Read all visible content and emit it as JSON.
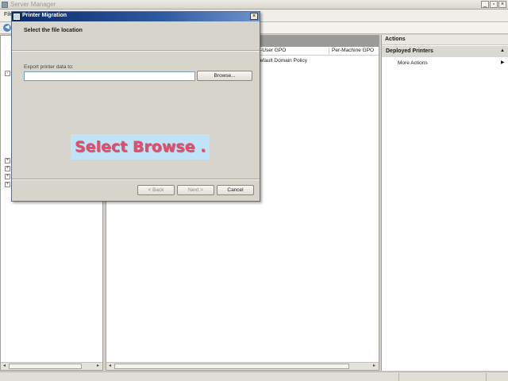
{
  "window": {
    "title": "Server Manager"
  },
  "menu": {
    "items": [
      "File"
    ]
  },
  "tree": {
    "expanders": [
      "-",
      "+",
      "+",
      "+",
      "+"
    ]
  },
  "table": {
    "columns": [
      "Per-User GPO",
      "Per-Machine GPO"
    ],
    "rows": [
      {
        "per_user_gpo": "Default Domain Policy",
        "per_machine_gpo": ""
      }
    ]
  },
  "actions": {
    "title": "Actions",
    "section": "Deployed Printers",
    "items": [
      "More Actions"
    ]
  },
  "dialog": {
    "title": "Printer Migration",
    "heading": "Select the file location",
    "field_label": "Export printer data to:",
    "path_value": "",
    "browse_label": "Browse...",
    "back_label": "< Back",
    "next_label": "Next >",
    "cancel_label": "Cancel"
  },
  "tooltip": {
    "text": "Select Browse ."
  }
}
